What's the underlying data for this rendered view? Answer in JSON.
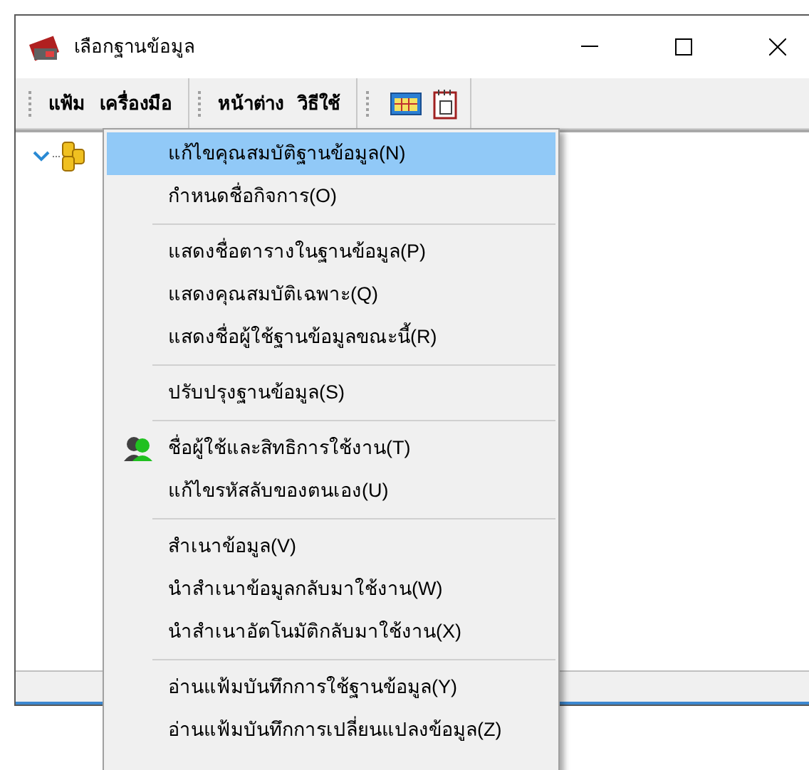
{
  "window": {
    "title": "เลือกฐานข้อมูล"
  },
  "menu_bar": [
    [
      "แฟ้ม",
      "เครื่องมือ"
    ],
    [
      "หน้าต่าง",
      "วิธีใช้"
    ]
  ],
  "tree": {
    "expanded": true
  },
  "dropdown_menu": [
    {
      "kind": "item",
      "label": "แก้ไขคุณสมบัติฐานข้อมูล(N)",
      "selected": true
    },
    {
      "kind": "item",
      "label": "กำหนดชื่อกิจการ(O)",
      "selected": false
    },
    {
      "kind": "separator"
    },
    {
      "kind": "item",
      "label": "แสดงชื่อตารางในฐานข้อมูล(P)",
      "selected": false
    },
    {
      "kind": "item",
      "label": "แสดงคุณสมบัติเฉพาะ(Q)",
      "selected": false
    },
    {
      "kind": "item",
      "label": "แสดงชื่อผู้ใช้ฐานข้อมูลขณะนี้(R)",
      "selected": false
    },
    {
      "kind": "separator"
    },
    {
      "kind": "item",
      "label": "ปรับปรุงฐานข้อมูล(S)",
      "selected": false
    },
    {
      "kind": "separator"
    },
    {
      "kind": "icon_item",
      "label": "ชื่อผู้ใช้และสิทธิการใช้งาน(T)",
      "selected": false
    },
    {
      "kind": "item",
      "label": "แก้ไขรหัสลับของตนเอง(U)",
      "selected": false
    },
    {
      "kind": "separator"
    },
    {
      "kind": "item",
      "label": "สำเนาข้อมูล(V)",
      "selected": false
    },
    {
      "kind": "item",
      "label": "นำสำเนาข้อมูลกลับมาใช้งาน(W)",
      "selected": false
    },
    {
      "kind": "item",
      "label": "นำสำเนาอัตโนมัติกลับมาใช้งาน(X)",
      "selected": false
    },
    {
      "kind": "separator"
    },
    {
      "kind": "item",
      "label": "อ่านแฟ้มบันทึกการใช้ฐานข้อมูล(Y)",
      "selected": false
    },
    {
      "kind": "item",
      "label": "อ่านแฟ้มบันทึกการเปลี่ยนแปลงข้อมูล(Z)",
      "selected": false
    }
  ]
}
